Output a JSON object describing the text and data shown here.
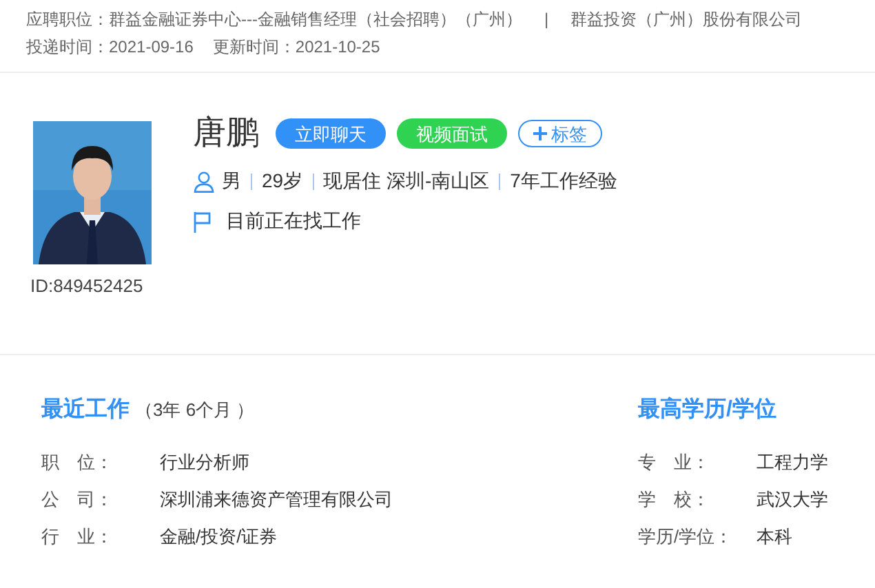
{
  "header": {
    "position_label": "应聘职位：",
    "position": "群益金融证券中心---金融销售经理（社会招聘）（广州）",
    "separator": "|",
    "company": "群益投资（广州）股份有限公司",
    "applied_label": "投递时间：",
    "applied": "2021-09-16",
    "updated_label": "更新时间：",
    "updated": "2021-10-25"
  },
  "profile": {
    "id": "ID:849452425",
    "name": "唐鹏",
    "actions": [
      {
        "kind": "chat",
        "label": "立即聊天"
      },
      {
        "kind": "video",
        "label": "视频面试"
      },
      {
        "kind": "tag",
        "label": "标签"
      }
    ],
    "facts": [
      "男",
      "29岁",
      "现居住 深圳-南山区",
      "7年工作经验"
    ],
    "status": "目前正在找工作"
  },
  "recent_work": {
    "title": "最近工作",
    "duration": "（3年 6个月 ）",
    "fields": [
      {
        "label": "职　位：",
        "value": "行业分析师"
      },
      {
        "label": "公　司：",
        "value": "深圳浦来德资产管理有限公司"
      },
      {
        "label": "行　业：",
        "value": "金融/投资/证券"
      }
    ]
  },
  "education": {
    "title": "最高学历/学位",
    "fields": [
      {
        "label": "专　业：",
        "value": "工程力学"
      },
      {
        "label": "学　校：",
        "value": "武汉大学"
      },
      {
        "label": "学历/学位：",
        "value": "本科"
      }
    ]
  }
}
